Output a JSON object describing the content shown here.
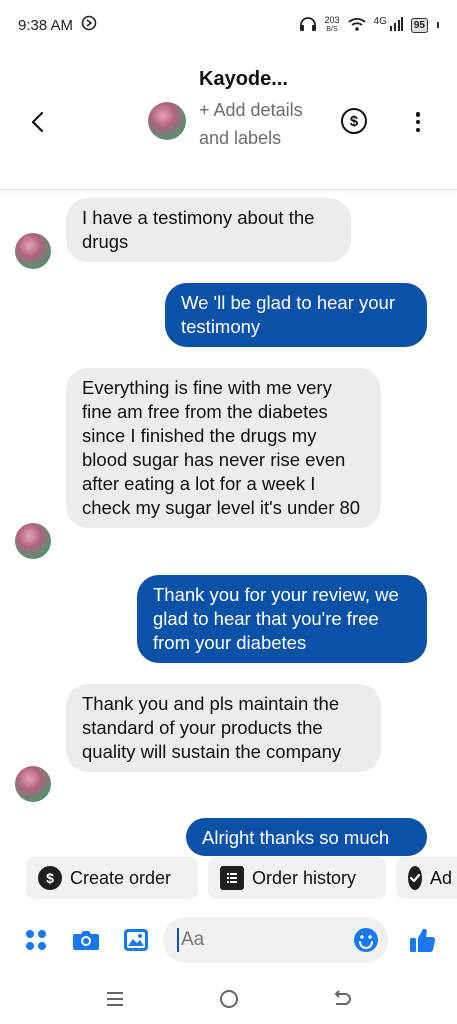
{
  "status_bar": {
    "time": "9:38 AM",
    "data_rate_value": "203",
    "data_rate_unit": "B/S",
    "network": "4G",
    "battery": "95"
  },
  "header": {
    "contact_name": "Kayode...",
    "subtitle": "+ Add details and labels",
    "pay_symbol": "$"
  },
  "messages": [
    {
      "direction": "incoming",
      "text": "I have a testimony about the drugs"
    },
    {
      "direction": "outgoing",
      "text": "We 'll be glad to hear your testimony"
    },
    {
      "direction": "incoming",
      "text": "Everything is fine with me very fine am free from the diabetes since I finished the drugs my blood sugar has never rise even after eating a lot for a week I check my sugar level it's under 80"
    },
    {
      "direction": "outgoing",
      "text": "Thank you for your review, we glad to hear that you're free from your diabetes"
    },
    {
      "direction": "incoming",
      "text": "Thank you and pls maintain the standard of your products the quality will sustain the company"
    },
    {
      "direction": "outgoing",
      "text": "Alright thanks so much"
    }
  ],
  "quick_actions": [
    {
      "label": "Create order",
      "icon": "dollar-icon"
    },
    {
      "label": "Order history",
      "icon": "list-icon"
    },
    {
      "label": "Ad",
      "icon": "check-icon"
    }
  ],
  "composer": {
    "placeholder": "Aa"
  },
  "colors": {
    "accent": "#0a52a8",
    "incoming_bubble": "#ececec",
    "icon_blue": "#1877f2"
  }
}
